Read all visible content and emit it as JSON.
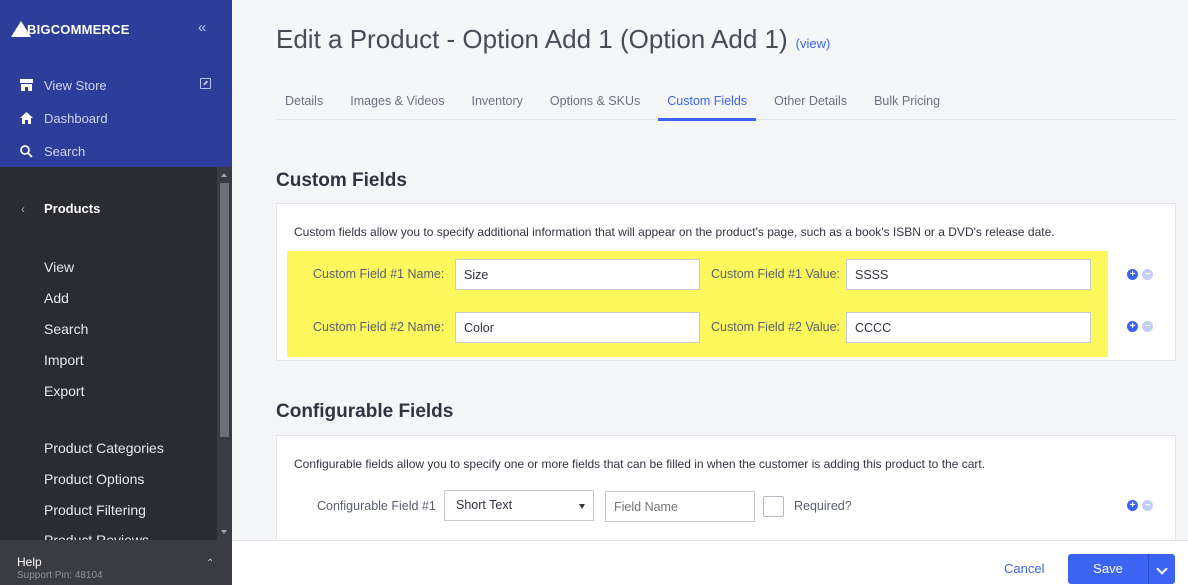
{
  "sidebar": {
    "brand": "BIGCOMMERCE",
    "collapse_glyph": "«",
    "view_store": "View Store",
    "dashboard": "Dashboard",
    "search": "Search",
    "section_heading": "Products",
    "back_glyph": "‹",
    "items": [
      "View",
      "Add",
      "Search",
      "Import",
      "Export",
      "Product Categories",
      "Product Options",
      "Product Filtering",
      "Product Reviews"
    ],
    "help": "Help",
    "support_pin": "Support Pin: 48104",
    "help_chevron": "⌃"
  },
  "header": {
    "title": "Edit a Product - Option Add 1 (Option Add 1)",
    "view_link": "(view)"
  },
  "tabs": [
    {
      "label": "Details",
      "active": false
    },
    {
      "label": "Images & Videos",
      "active": false
    },
    {
      "label": "Inventory",
      "active": false
    },
    {
      "label": "Options & SKUs",
      "active": false
    },
    {
      "label": "Custom Fields",
      "active": true
    },
    {
      "label": "Other Details",
      "active": false
    },
    {
      "label": "Bulk Pricing",
      "active": false
    }
  ],
  "custom_fields": {
    "title": "Custom Fields",
    "description": "Custom fields allow you to specify additional information that will appear on the product's page, such as a book's ISBN or a DVD's release date.",
    "rows": [
      {
        "name_label": "Custom Field #1 Name:",
        "name_value": "Size",
        "value_label": "Custom Field #1 Value:",
        "value_value": "SSSS"
      },
      {
        "name_label": "Custom Field #2 Name:",
        "name_value": "Color",
        "value_label": "Custom Field #2 Value:",
        "value_value": "CCCC"
      }
    ],
    "highlight_color": "#fdf85b"
  },
  "configurable_fields": {
    "title": "Configurable Fields",
    "description": "Configurable fields allow you to specify one or more fields that can be filled in when the customer is adding this product to the cart.",
    "row_label": "Configurable Field #1",
    "type_selected": "Short Text",
    "name_placeholder": "Field Name",
    "required_label": "Required?"
  },
  "footer": {
    "cancel": "Cancel",
    "save": "Save"
  },
  "colors": {
    "accent": "#3c64f4",
    "sidebar_top": "#2c3e99",
    "sidebar_dark": "#2a2c32"
  }
}
